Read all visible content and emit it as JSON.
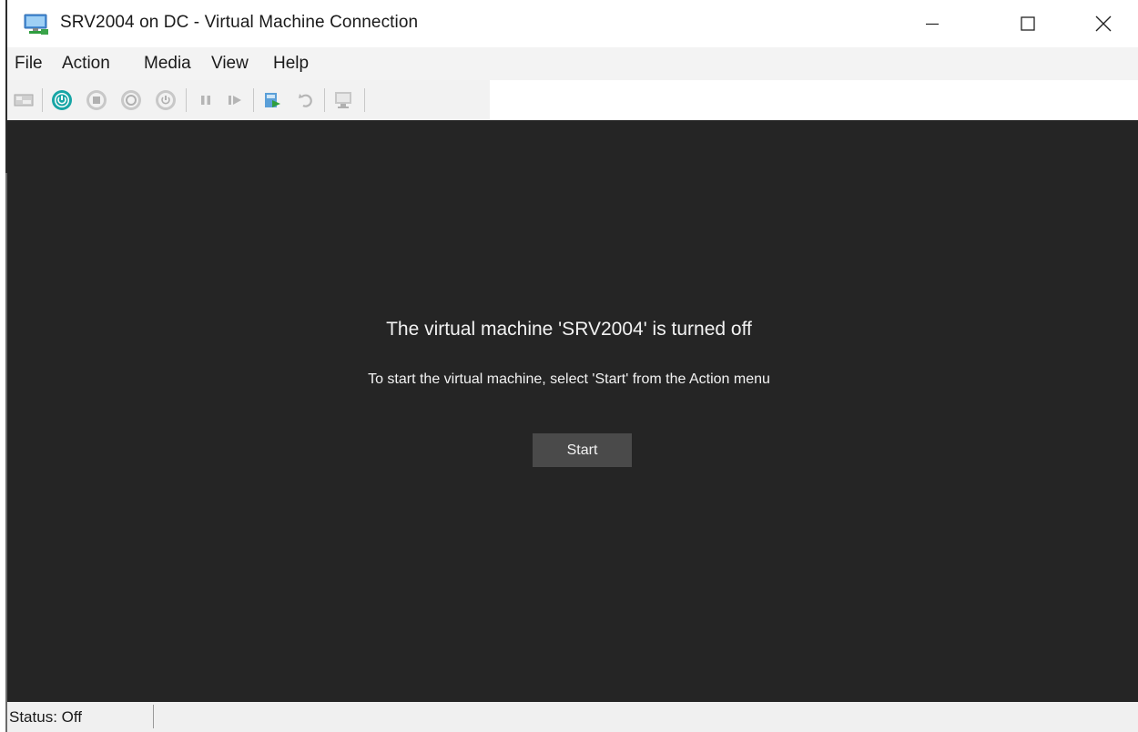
{
  "window": {
    "title": "SRV2004 on DC - Virtual Machine Connection",
    "icon": "vm-monitor-icon"
  },
  "controls": {
    "minimize_icon": "minimize-icon",
    "maximize_icon": "maximize-icon",
    "close_icon": "close-icon"
  },
  "menu": [
    "File",
    "Action",
    "Media",
    "View",
    "Help"
  ],
  "toolbar": [
    "ctrl-alt-del-icon",
    "start-icon",
    "turn-off-icon",
    "shut-down-icon",
    "save-icon",
    "pause-icon",
    "resume-icon",
    "checkpoint-icon",
    "revert-icon",
    "enhanced-session-icon"
  ],
  "screen": {
    "heading": "The virtual machine 'SRV2004' is turned off",
    "instruction": "To start the virtual machine, select 'Start' from the Action menu",
    "start_label": "Start"
  },
  "status": {
    "text": "Status: Off"
  },
  "colors": {
    "screen_bg": "#252525",
    "start_icon": "#16a3a3",
    "button_bg": "#4a4a4a",
    "text_light": "#f2f2f2"
  }
}
